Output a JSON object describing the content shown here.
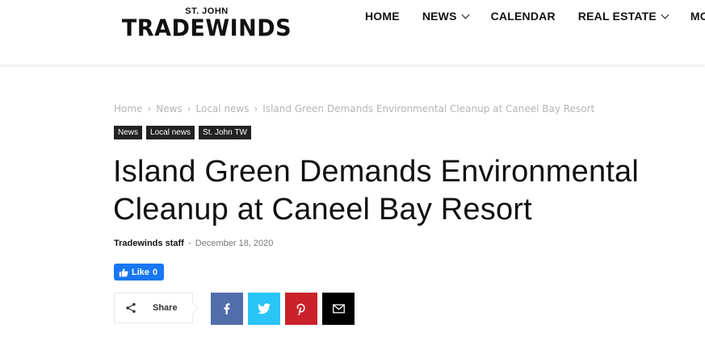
{
  "brand": {
    "small": "ST. JOHN",
    "big": "TRADEWINDS"
  },
  "nav": {
    "items": [
      {
        "label": "HOME",
        "dropdown": false
      },
      {
        "label": "NEWS",
        "dropdown": true
      },
      {
        "label": "CALENDAR",
        "dropdown": false
      },
      {
        "label": "REAL ESTATE",
        "dropdown": true
      },
      {
        "label": "MOR",
        "dropdown": false
      }
    ]
  },
  "breadcrumb": {
    "items": [
      "Home",
      "News",
      "Local news",
      "Island Green Demands Environmental Cleanup at Caneel Bay Resort"
    ],
    "separator": "›"
  },
  "tags": [
    "News",
    "Local news",
    "St. John TW"
  ],
  "article": {
    "title_line1": "Island Green Demands Environmental",
    "title_line2": "Cleanup at Caneel Bay Resort",
    "author": "Tradewinds staff",
    "dash": "-",
    "date": "December 18, 2020"
  },
  "facebook_like": {
    "label": "Like",
    "count": "0"
  },
  "share": {
    "label": "Share",
    "icon": "share-icon",
    "buttons": [
      {
        "name": "facebook",
        "icon": "facebook-icon",
        "color": "#516eab"
      },
      {
        "name": "twitter",
        "icon": "twitter-icon",
        "color": "#29c5f6"
      },
      {
        "name": "pinterest",
        "icon": "pinterest-icon",
        "color": "#ca212a"
      },
      {
        "name": "email",
        "icon": "email-icon",
        "color": "#000000"
      }
    ]
  }
}
